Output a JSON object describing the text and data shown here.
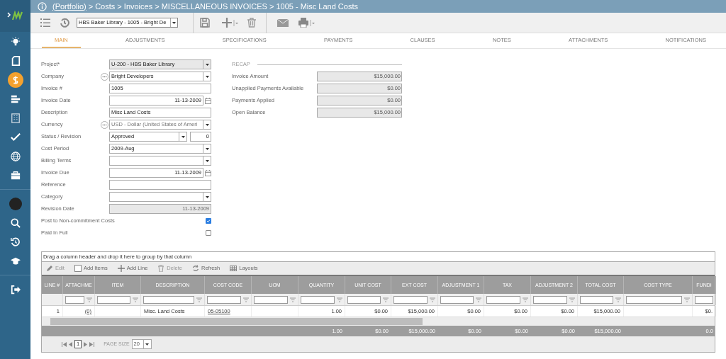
{
  "breadcrumb": {
    "link": "(Portfolio)",
    "path": "> Costs > Invoices > MISCELLANEOUS INVOICES > 1005 - Misc Land Costs"
  },
  "sidebar": {
    "items": [
      {
        "selected": false
      },
      {
        "selected": false
      },
      {
        "selected": true
      },
      {
        "selected": false
      },
      {
        "selected": false
      },
      {
        "selected": false
      },
      {
        "selected": false
      },
      {
        "selected": false
      },
      {
        "selected": false
      },
      {
        "selected": false
      },
      {
        "selected": false
      },
      {
        "selected": false
      },
      {
        "selected": false
      }
    ]
  },
  "toolbar": {
    "record_selector": "HBS Baker Library - 1005 - Bright De"
  },
  "tabs": [
    {
      "label": "MAIN",
      "selected": true
    },
    {
      "label": "ADJUSTMENTS",
      "selected": false
    },
    {
      "label": "SPECIFICATIONS",
      "selected": false
    },
    {
      "label": "PAYMENTS",
      "selected": false
    },
    {
      "label": "CLAUSES",
      "selected": false
    },
    {
      "label": "NOTES",
      "selected": false
    },
    {
      "label": "ATTACHMENTS",
      "selected": false
    },
    {
      "label": "NOTIFICATIONS",
      "selected": false
    }
  ],
  "form": {
    "fields": [
      {
        "label": "Project*",
        "kind": "select",
        "value": "U-200 - HBS Baker Library",
        "disabled": true
      },
      {
        "label": "Company",
        "kind": "select",
        "value": "Bright Developers",
        "lookup": true,
        "disabled": false
      },
      {
        "label": "Invoice #",
        "kind": "text",
        "value": "1005",
        "disabled": false
      },
      {
        "label": "Invoice Date",
        "kind": "date",
        "value": "11-13-2009",
        "disabled": false
      },
      {
        "label": "Description",
        "kind": "text",
        "value": "Misc Land Costs",
        "disabled": false
      },
      {
        "label": "Currency",
        "kind": "select",
        "value": "USD - Dollar (United States of Ameri",
        "lookup": true,
        "disabled": false
      },
      {
        "label": "Status / Revision",
        "kind": "status",
        "value": "Approved",
        "revision": "0",
        "disabled": false
      },
      {
        "label": "Cost Period",
        "kind": "select",
        "value": "2009-Aug",
        "disabled": false
      },
      {
        "label": "Billing Terms",
        "kind": "select",
        "disabled": false
      },
      {
        "label": "Invoice Due",
        "kind": "date",
        "value": "11-13-2009",
        "disabled": false
      },
      {
        "label": "Reference",
        "kind": "text",
        "disabled": false
      },
      {
        "label": "Category",
        "kind": "select",
        "disabled": false
      },
      {
        "label": "Revision Date",
        "kind": "text",
        "value": "11-13-2009",
        "disabled": true
      },
      {
        "label": "Post to Non-commitment Costs",
        "kind": "checkbox",
        "checked": true
      },
      {
        "label": "Paid In Full",
        "kind": "checkbox",
        "checked": false
      }
    ]
  },
  "recap": {
    "title": "RECAP",
    "rows": [
      {
        "label": "Invoice Amount",
        "value": "$15,000.00"
      },
      {
        "label": "Unapplied Payments Available",
        "value": "$0.00"
      },
      {
        "label": "Payments Applied",
        "value": "$0.00"
      },
      {
        "label": "Open Balance",
        "value": "$15,000.00"
      }
    ]
  },
  "grid": {
    "group_hint": "Drag a column header and drop it here to group by that column",
    "actions": [
      {
        "label": "Edit",
        "disabled": true
      },
      {
        "label": "Add Items",
        "disabled": false
      },
      {
        "label": "Add Line",
        "disabled": false
      },
      {
        "label": "Delete",
        "disabled": true
      },
      {
        "label": "Refresh",
        "disabled": false
      },
      {
        "label": "Layouts",
        "disabled": false
      }
    ],
    "columns": [
      {
        "title": "LINE #",
        "kind": "number",
        "filter": false
      },
      {
        "title": "ATTACHME",
        "kind": "link",
        "filter": true
      },
      {
        "title": "ITEM",
        "kind": "text",
        "filter": true
      },
      {
        "title": "DESCRIPTION",
        "kind": "text",
        "filter": true
      },
      {
        "title": "COST CODE",
        "kind": "link",
        "filter": true
      },
      {
        "title": "UOM",
        "kind": "text",
        "filter": true
      },
      {
        "title": "QUANTITY",
        "kind": "number",
        "filter": true,
        "total": "1.00"
      },
      {
        "title": "UNIT COST",
        "kind": "number",
        "filter": true,
        "total": "$0.00"
      },
      {
        "title": "EXT COST",
        "kind": "number",
        "filter": true,
        "total": "$15,000.00"
      },
      {
        "title": "ADJUSTMENT 1",
        "kind": "number",
        "filter": true,
        "total": "$0.00"
      },
      {
        "title": "TAX",
        "kind": "number",
        "filter": true,
        "total": "$0.00"
      },
      {
        "title": "ADJUSTMENT 2",
        "kind": "number",
        "filter": true,
        "total": "$0.00"
      },
      {
        "title": "TOTAL COST",
        "kind": "number",
        "filter": true,
        "total": "$15,000.00"
      },
      {
        "title": "COST TYPE",
        "kind": "text",
        "filter": true
      },
      {
        "title": "FUNDI",
        "kind": "number",
        "filter": true,
        "total": "0.0"
      }
    ],
    "rows": [
      [
        "1",
        "(0)",
        null,
        "Misc. Land Costs",
        "05-05100",
        null,
        "1.00",
        "$0.00",
        "$15,000.00",
        "$0.00",
        "$0.00",
        "$0.00",
        "$15,000.00",
        null,
        "$0."
      ]
    ],
    "pager": {
      "page": "1",
      "page_size_label": "PAGE SIZE",
      "page_size": "20"
    }
  }
}
